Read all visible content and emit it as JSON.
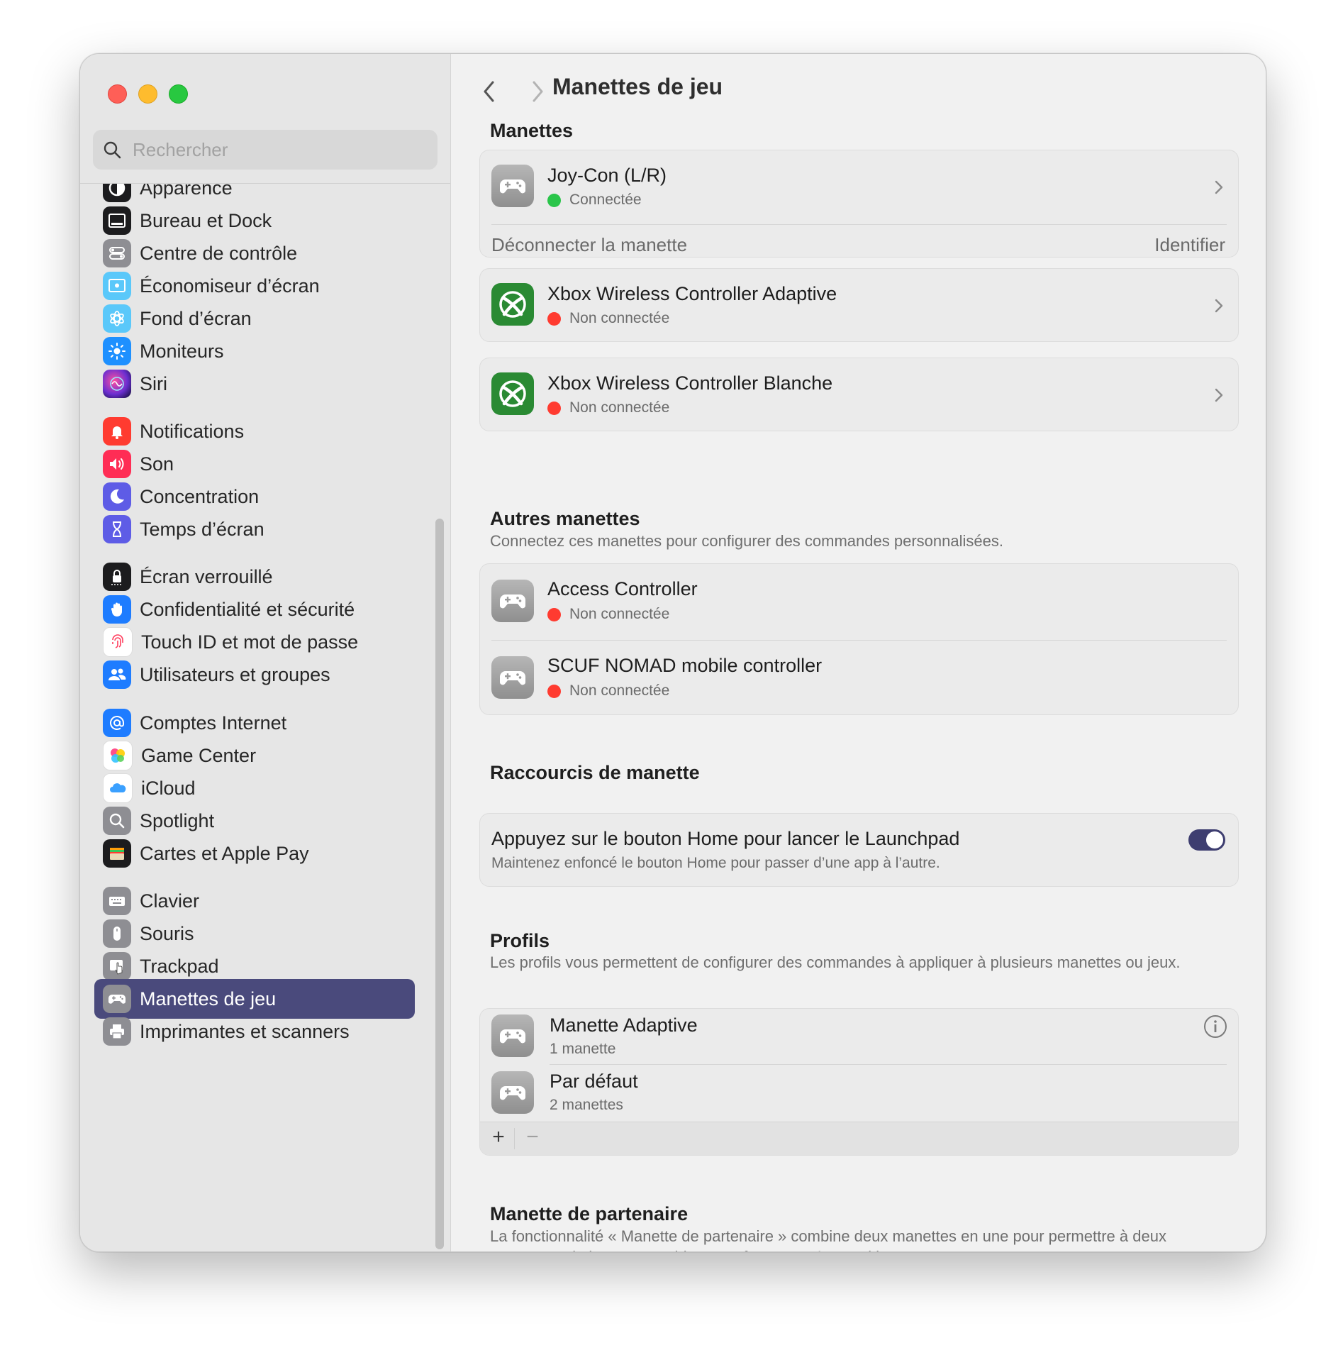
{
  "window": {
    "title": "Manettes de jeu"
  },
  "search": {
    "placeholder": "Rechercher"
  },
  "sidebar": {
    "items": [
      {
        "label": "Apparence",
        "icon": "appearance-icon",
        "color": "#1c1c1e"
      },
      {
        "label": "Bureau et Dock",
        "icon": "dock-icon",
        "color": "#1c1c1e"
      },
      {
        "label": "Centre de contrôle",
        "icon": "control-center-icon",
        "color": "#8e8e93"
      },
      {
        "label": "Économiseur d’écran",
        "icon": "screensaver-icon",
        "color": "#5ac8fa"
      },
      {
        "label": "Fond d’écran",
        "icon": "wallpaper-icon",
        "color": "#5ac8fa"
      },
      {
        "label": "Moniteurs",
        "icon": "displays-icon",
        "color": "#1e90ff"
      },
      {
        "label": "Siri",
        "icon": "siri-icon",
        "color": "#6b2fd1"
      },
      {
        "label": "Notifications",
        "icon": "bell-icon",
        "color": "#ff3b30"
      },
      {
        "label": "Son",
        "icon": "speaker-icon",
        "color": "#ff2d55"
      },
      {
        "label": "Concentration",
        "icon": "moon-icon",
        "color": "#5e5ce6"
      },
      {
        "label": "Temps d’écran",
        "icon": "hourglass-icon",
        "color": "#5e5ce6"
      },
      {
        "label": "Écran verrouillé",
        "icon": "lock-icon",
        "color": "#1c1c1e"
      },
      {
        "label": "Confidentialité et sécurité",
        "icon": "hand-icon",
        "color": "#1e7cff"
      },
      {
        "label": "Touch ID et mot de passe",
        "icon": "fingerprint-icon",
        "color": "#ffffff"
      },
      {
        "label": "Utilisateurs et groupes",
        "icon": "users-icon",
        "color": "#1e7cff"
      },
      {
        "label": "Comptes Internet",
        "icon": "at-icon",
        "color": "#1e7cff"
      },
      {
        "label": "Game Center",
        "icon": "game-center-icon",
        "color": "#ffffff"
      },
      {
        "label": "iCloud",
        "icon": "cloud-icon",
        "color": "#ffffff"
      },
      {
        "label": "Spotlight",
        "icon": "magnifier-icon",
        "color": "#8e8e93"
      },
      {
        "label": "Cartes et Apple Pay",
        "icon": "wallet-icon",
        "color": "#1c1c1e"
      },
      {
        "label": "Clavier",
        "icon": "keyboard-icon",
        "color": "#8e8e93"
      },
      {
        "label": "Souris",
        "icon": "mouse-icon",
        "color": "#8e8e93"
      },
      {
        "label": "Trackpad",
        "icon": "trackpad-icon",
        "color": "#8e8e93"
      },
      {
        "label": "Manettes de jeu",
        "icon": "gamepad-icon",
        "color": "#8e8e93",
        "selected": true
      },
      {
        "label": "Imprimantes et scanners",
        "icon": "printer-icon",
        "color": "#8e8e93"
      }
    ]
  },
  "main": {
    "sections": {
      "manettes": {
        "title": "Manettes"
      },
      "autres": {
        "title": "Autres manettes",
        "subtitle": "Connectez ces manettes pour configurer des commandes personnalisées."
      },
      "raccourcis": {
        "title": "Raccourcis de manette"
      },
      "profils": {
        "title": "Profils",
        "subtitle": "Les profils vous permettent de configurer des commandes à appliquer à plusieurs manettes ou jeux."
      },
      "partenaire": {
        "title": "Manette de partenaire",
        "subtitle": "La fonctionnalité « Manette de partenaire » combine deux manettes en une pour permettre à deux personnes de jouer ensemble en ne formant qu’un seul joueur."
      }
    },
    "controllers": [
      {
        "name": "Joy-Con (L/R)",
        "status": "Connectée",
        "connected": true,
        "disconnect_label": "Déconnecter la manette",
        "identify_label": "Identifier"
      },
      {
        "name": "Xbox Wireless Controller Adaptive",
        "status": "Non connectée",
        "connected": false
      },
      {
        "name": "Xbox Wireless Controller Blanche",
        "status": "Non connectée",
        "connected": false
      }
    ],
    "other_controllers": [
      {
        "name": "Access Controller",
        "status": "Non connectée"
      },
      {
        "name": "SCUF NOMAD mobile controller",
        "status": "Non connectée"
      }
    ],
    "shortcut": {
      "title": "Appuyez sur le bouton Home pour lancer le Launchpad",
      "subtitle": "Maintenez enfoncé le bouton Home pour passer d’une app à l’autre.",
      "enabled": true
    },
    "profiles": [
      {
        "name": "Manette Adaptive",
        "count": "1 manette"
      },
      {
        "name": "Par défaut",
        "count": "2 manettes"
      }
    ],
    "profile_buttons": {
      "add": "+",
      "remove": "−"
    }
  },
  "colors": {
    "accent": "#4a4a7c",
    "connected": "#2ac54a",
    "disconnected": "#ff3b30",
    "xbox": "#2a8a33"
  }
}
